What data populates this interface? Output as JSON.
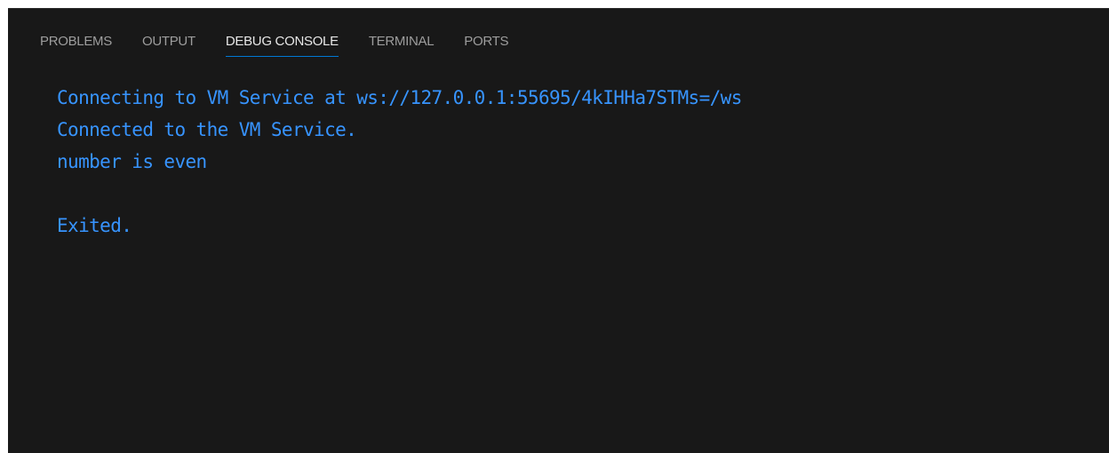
{
  "tabs": [
    {
      "label": "PROBLEMS",
      "active": false
    },
    {
      "label": "OUTPUT",
      "active": false
    },
    {
      "label": "DEBUG CONSOLE",
      "active": true
    },
    {
      "label": "TERMINAL",
      "active": false
    },
    {
      "label": "PORTS",
      "active": false
    }
  ],
  "console": {
    "lines": [
      "Connecting to VM Service at ws://127.0.0.1:55695/4kIHHa7STMs=/ws",
      "Connected to the VM Service.",
      "number is even",
      "",
      "Exited."
    ]
  },
  "colors": {
    "panel_background": "#181818",
    "console_text": "#3794ff",
    "active_tab_underline": "#0078d4",
    "active_tab_text": "#e7e7e7",
    "inactive_tab_text": "#9d9d9d"
  }
}
